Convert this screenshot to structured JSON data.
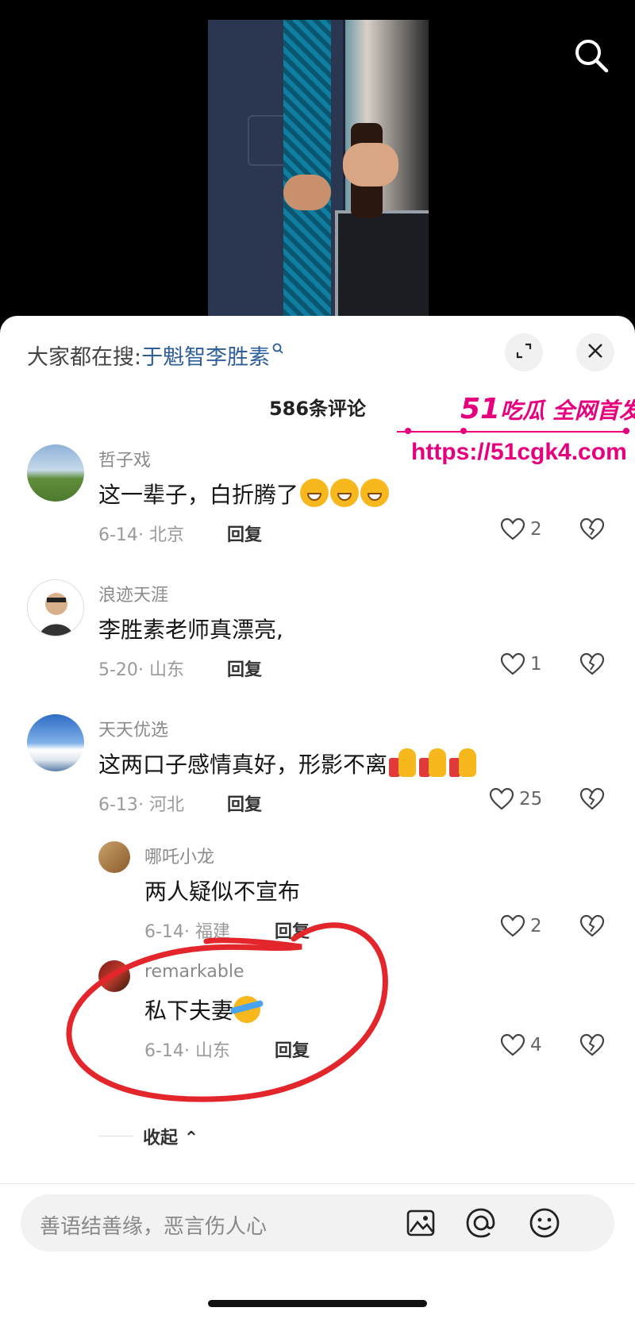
{
  "hot_search": {
    "prefix": "大家都在搜:",
    "keyword": "于魁智李胜素"
  },
  "comment_count": "586条评论",
  "watermark": {
    "brand_num": "51",
    "brand_text": "吃瓜 全网首发",
    "url": "https://51cgk4.com"
  },
  "comments": [
    {
      "user": "哲子戏",
      "text": "这一辈子，白折腾了",
      "emoji": [
        "laughing-emoji",
        "laughing-emoji",
        "laughing-emoji"
      ],
      "date": "6-14",
      "location": "北京",
      "reply": "回复",
      "likes": "2"
    },
    {
      "user": "浪迹天涯",
      "text": "李胜素老师真漂亮,",
      "date": "5-20",
      "location": "山东",
      "reply": "回复",
      "likes": "1"
    },
    {
      "user": "天天优选",
      "text": "这两口子感情真好，形影不离",
      "emoji": [
        "thumbs-up-emoji",
        "thumbs-up-emoji",
        "thumbs-up-emoji"
      ],
      "date": "6-13",
      "location": "河北",
      "reply": "回复",
      "likes": "25",
      "replies": [
        {
          "user": "哪吒小龙",
          "text": "两人疑似不宣布",
          "date": "6-14",
          "location": "福建",
          "reply": "回复",
          "likes": "2"
        },
        {
          "user": "remarkable",
          "text": "私下夫妻",
          "emoji": [
            "crying-laughing-emoji"
          ],
          "date": "6-14",
          "location": "山东",
          "reply": "回复",
          "likes": "4"
        }
      ],
      "collapse": "收起"
    }
  ],
  "input": {
    "placeholder": "善语结善缘，恶言伤人心"
  },
  "icons": {
    "search": "search-icon",
    "expand": "expand-icon",
    "close": "close-icon",
    "like": "heart-icon",
    "dislike": "broken-heart-icon",
    "image": "image-icon",
    "mention": "at-icon",
    "emoji": "smiley-icon"
  },
  "colors": {
    "link": "#2e5e9c",
    "watermark": "#e6007e",
    "annotation": "#e3262b"
  }
}
